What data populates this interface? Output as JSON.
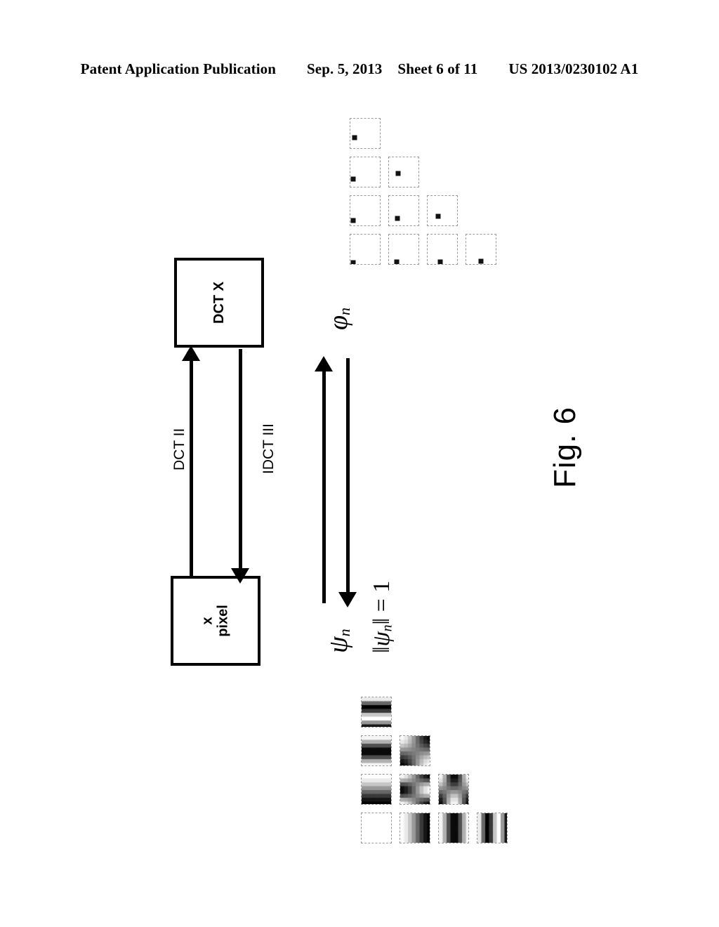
{
  "header": {
    "publication": "Patent Application Publication",
    "date": "Sep. 5, 2013",
    "sheet": "Sheet 6 of 11",
    "document_number": "US 2013/0230102 A1"
  },
  "figure": {
    "caption": "Fig. 6",
    "blocks": [
      {
        "id": "dct-x",
        "label": "DCT X"
      },
      {
        "id": "x-pixel",
        "label": "x\npixel"
      }
    ],
    "arrow_labels": {
      "forward": "DCT II",
      "inverse": "IDCT III"
    },
    "basis_labels": {
      "frequency_symbol": "φ",
      "frequency_subscript": "n",
      "spatial_symbol": "ψ",
      "spatial_subscript": "n",
      "norm_constraint": "‖ψ_n‖ = 1",
      "norm_value": "1"
    },
    "top_grid": {
      "description": "frequency-domain delta (spike) basis tiles",
      "rows": [
        {
          "count": 1,
          "spikes": [
            {
              "cx": 0.14,
              "cy": 0.62
            }
          ]
        },
        {
          "count": 2,
          "spikes": [
            {
              "cx": 0.1,
              "cy": 0.7
            },
            {
              "cx": 0.3,
              "cy": 0.52
            }
          ]
        },
        {
          "count": 3,
          "spikes": [
            {
              "cx": 0.1,
              "cy": 0.8
            },
            {
              "cx": 0.28,
              "cy": 0.72
            },
            {
              "cx": 0.33,
              "cy": 0.66
            }
          ]
        },
        {
          "count": 4,
          "spikes": [
            {
              "cx": 0.1,
              "cy": 0.9
            },
            {
              "cx": 0.26,
              "cy": 0.88
            },
            {
              "cx": 0.4,
              "cy": 0.88
            },
            {
              "cx": 0.48,
              "cy": 0.86
            }
          ]
        }
      ]
    },
    "bottom_grid": {
      "description": "spatial-domain DCT basis function tiles",
      "rows": [
        {
          "count": 1,
          "patterns": [
            "horiz-stripes-3"
          ]
        },
        {
          "count": 2,
          "patterns": [
            "horiz-stripes-2",
            "checker-2x2"
          ]
        },
        {
          "count": 3,
          "patterns": [
            "horiz-stripes-1",
            "checker-diag",
            "checker-vert-blob"
          ]
        },
        {
          "count": 4,
          "patterns": [
            "flat-dc",
            "vert-stripes-1",
            "vert-stripes-2",
            "vert-stripes-3"
          ]
        }
      ]
    }
  },
  "colors": {
    "ink": "#000000",
    "paper": "#ffffff",
    "tile_border": "#9a9a9a"
  }
}
